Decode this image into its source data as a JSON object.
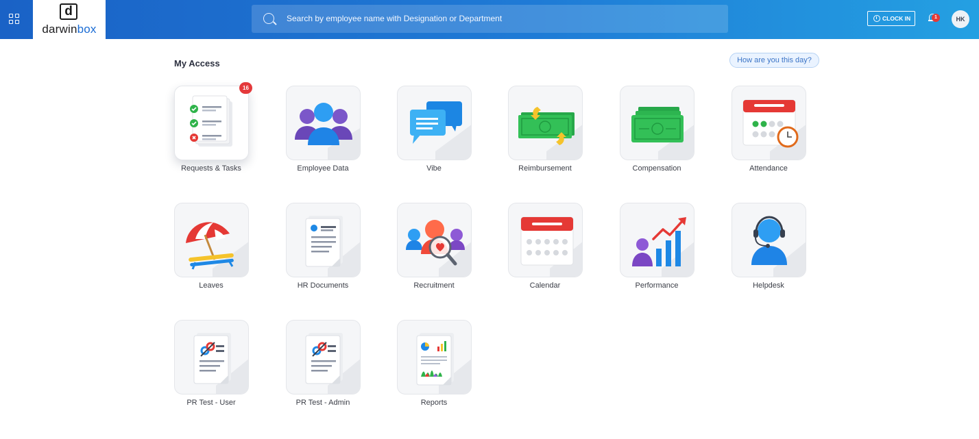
{
  "header": {
    "logo_mark": "d",
    "logo_text_a": "darwin",
    "logo_text_b": "box",
    "search_placeholder": "Search by employee name with Designation or Department",
    "clock_in_label": "CLOCK IN",
    "notification_count": "1",
    "avatar_initials": "HK"
  },
  "main": {
    "heading": "My Access",
    "mood_button": "How are you this day?",
    "tiles": [
      {
        "label": "Requests & Tasks",
        "badge": "16",
        "icon": "requests-tasks-icon"
      },
      {
        "label": "Employee Data",
        "icon": "employee-data-icon"
      },
      {
        "label": "Vibe",
        "icon": "vibe-icon"
      },
      {
        "label": "Reimbursement",
        "icon": "reimbursement-icon"
      },
      {
        "label": "Compensation",
        "icon": "compensation-icon"
      },
      {
        "label": "Attendance",
        "icon": "attendance-icon"
      },
      {
        "label": "Leaves",
        "icon": "leaves-icon"
      },
      {
        "label": "HR Documents",
        "icon": "hr-documents-icon"
      },
      {
        "label": "Recruitment",
        "icon": "recruitment-icon"
      },
      {
        "label": "Calendar",
        "icon": "calendar-icon"
      },
      {
        "label": "Performance",
        "icon": "performance-icon"
      },
      {
        "label": "Helpdesk",
        "icon": "helpdesk-icon"
      },
      {
        "label": "PR Test - User",
        "icon": "pr-test-user-icon"
      },
      {
        "label": "PR Test - Admin",
        "icon": "pr-test-admin-icon"
      },
      {
        "label": "Reports",
        "icon": "reports-icon"
      }
    ]
  },
  "colors": {
    "header_start": "#1a62c6",
    "header_end": "#24a0e2",
    "badge_red": "#e4393b",
    "brand_blue": "#1a6cd4"
  }
}
